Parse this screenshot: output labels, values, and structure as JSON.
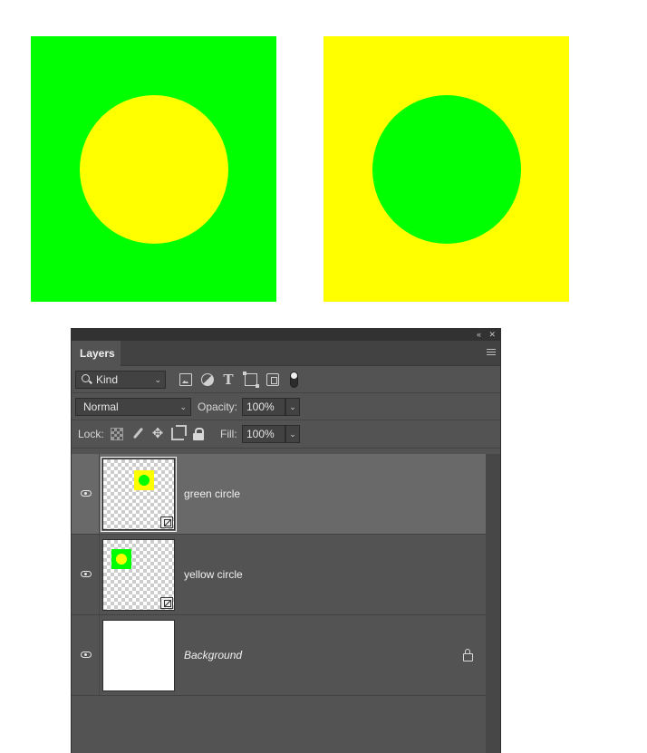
{
  "colors": {
    "green": "#00ff00",
    "yellow": "#ffff00"
  },
  "artwork": {
    "left": {
      "background": "#00ff00",
      "circle": "#ffff00"
    },
    "right": {
      "background": "#ffff00",
      "circle": "#00ff00"
    }
  },
  "panel": {
    "tab": "Layers",
    "filter": {
      "kind_label": "Kind"
    },
    "blend_mode": "Normal",
    "opacity_label": "Opacity:",
    "opacity_value": "100%",
    "lock_label": "Lock:",
    "fill_label": "Fill:",
    "fill_value": "100%",
    "layers": [
      {
        "name": "green circle",
        "selected": true
      },
      {
        "name": "yellow circle",
        "selected": false
      },
      {
        "name": "Background",
        "selected": false,
        "locked": true
      }
    ]
  },
  "icons": {
    "search": "search-icon",
    "eye": "eye-icon",
    "lock": "lock-icon",
    "menu": "hamburger-menu-icon",
    "collapse": "double-chevron-left-icon",
    "close": "close-icon"
  }
}
